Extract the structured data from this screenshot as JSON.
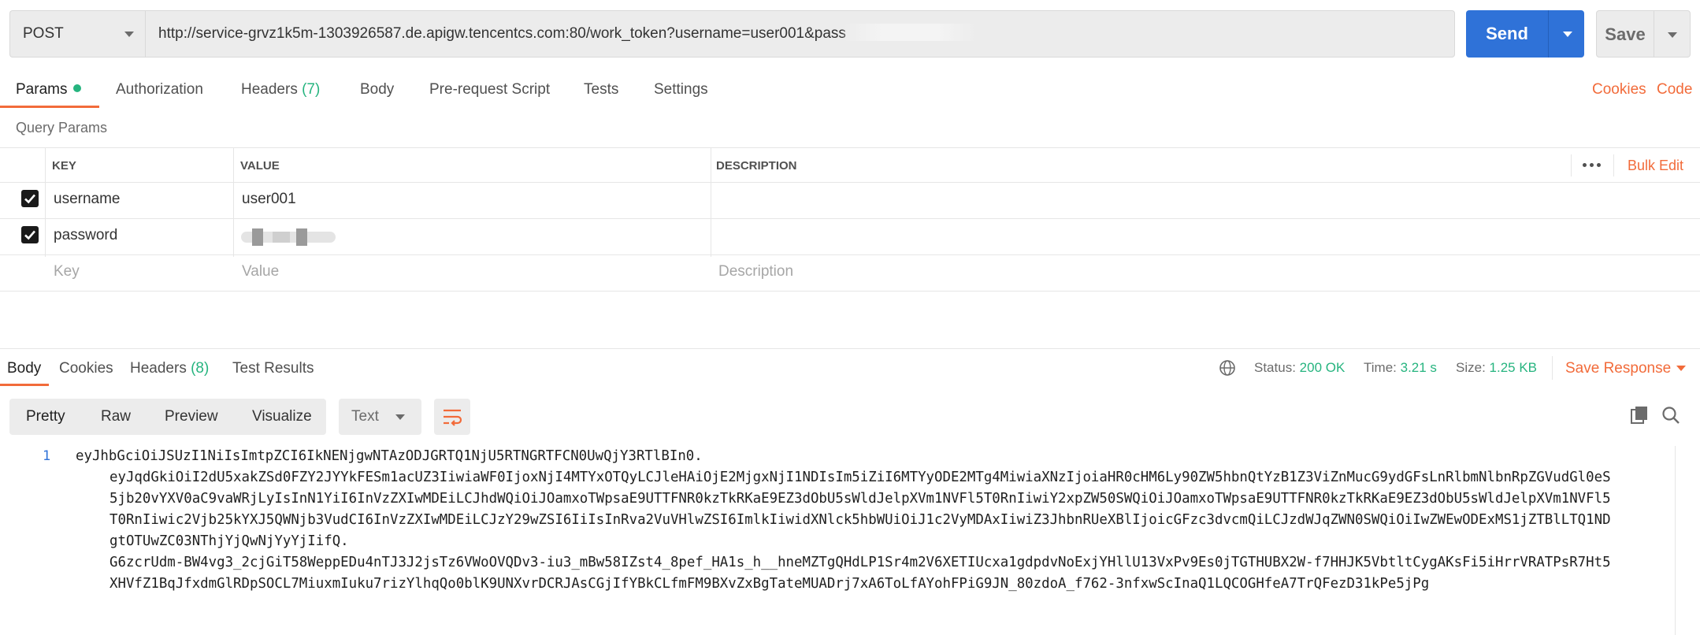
{
  "request": {
    "method": "POST",
    "url": "http://service-grvz1k5m-1303926587.de.apigw.tencentcs.com:80/work_token?username=user001&pass",
    "send_label": "Send",
    "save_label": "Save"
  },
  "request_tabs": {
    "params": "Params",
    "authorization": "Authorization",
    "headers": "Headers",
    "headers_count": "(7)",
    "body": "Body",
    "prerequest": "Pre-request Script",
    "tests": "Tests",
    "settings": "Settings",
    "cookies": "Cookies",
    "code": "Code"
  },
  "query_params": {
    "title": "Query Params",
    "columns": {
      "key": "KEY",
      "value": "VALUE",
      "description": "DESCRIPTION"
    },
    "bulk_edit": "Bulk Edit",
    "rows": [
      {
        "key": "username",
        "value": "user001",
        "checked": true
      },
      {
        "key": "password",
        "value": "",
        "checked": true
      }
    ],
    "placeholders": {
      "key": "Key",
      "value": "Value",
      "description": "Description"
    }
  },
  "response_tabs": {
    "body": "Body",
    "cookies": "Cookies",
    "headers": "Headers",
    "headers_count": "(8)",
    "test_results": "Test Results"
  },
  "response_status": {
    "status_label": "Status:",
    "status_value": "200 OK",
    "time_label": "Time:",
    "time_value": "3.21 s",
    "size_label": "Size:",
    "size_value": "1.25 KB",
    "save_response": "Save Response"
  },
  "view_modes": {
    "pretty": "Pretty",
    "raw": "Raw",
    "preview": "Preview",
    "visualize": "Visualize",
    "format": "Text"
  },
  "response_body": {
    "line_number": "1",
    "lines": [
      "eyJhbGciOiJSUzI1NiIsImtpZCI6IkNENjgwNTAzODJGRTQ1NjU5RTNGRTFCN0UwQjY3RTlBIn0.",
      "eyJqdGkiOiI2dU5xakZSd0FZY2JYYkFESm1acUZ3IiwiaWF0IjoxNjI4MTYxOTQyLCJleHAiOjE2MjgxNjI1NDIsIm5iZiI6MTYyODE2MTg4MiwiaXNzIjoiaHR0cHM6Ly90ZW5hbnQtYzB1Z3ViZnMucG9ydGFsLnRlbmNlbnRpZGVudGl0eS",
      "5jb20vYXV0aC9vaWRjLyIsInN1YiI6InVzZXIwMDEiLCJhdWQiOiJOamxoTWpsaE9UTTFNR0kzTkRKaE9EZ3dObU5sWldJelpXVm1NVFl5T0RnIiwiY2xpZW50SWQiOiJOamxoTWpsaE9UTTFNR0kzTkRKaE9EZ3dObU5sWldJelpXVm1NVFl5",
      "T0RnIiwic2Vjb25kYXJ5QWNjb3VudCI6InVzZXIwMDEiLCJzY29wZSI6IiIsInRva2VuVHlwZSI6ImlkIiwidXNlck5hbWUiOiJ1c2VyMDAxIiwiZ3JhbnRUeXBlIjoicGFzc3dvcmQiLCJzdWJqZWN0SWQiOiIwZWEwODExMS1jZTBlLTQ1ND",
      "gtOTUwZC03NThjYjQwNjYyYjIifQ.",
      "G6zcrUdm-BW4vg3_2cjGiT58WeppEDu4nTJ3J2jsTz6VWoOVQDv3-iu3_mBw58IZst4_8pef_HA1s_h__hneMZTgQHdLP1Sr4m2V6XETIUcxa1gdpdvNoExjYHllU13VxPv9Es0jTGTHUBX2W-f7HHJK5VbtltCygAKsFi5iHrrVRATPsR7Ht5",
      "XHVfZ1BqJfxdmGlRDpSOCL7MiuxmIuku7rizYlhqQo0blK9UNXvrDCRJAsCGjIfYBkCLfmFM9BXvZxBgTateMUADrj7xA6ToLfAYohFPiG9JN_80zdoA_f762-3nfxwScInaQ1LQCOGHfeA7TrQFezD31kPe5jPg"
    ]
  },
  "colors": {
    "accent_orange": "#f26b3a",
    "send_blue": "#2f72d8",
    "status_green": "#26b47f"
  },
  "icons": [
    "caret-down-icon",
    "checkbox-checked-icon",
    "more-horizontal-icon",
    "globe-icon",
    "wrap-lines-icon",
    "copy-icon",
    "search-icon"
  ]
}
